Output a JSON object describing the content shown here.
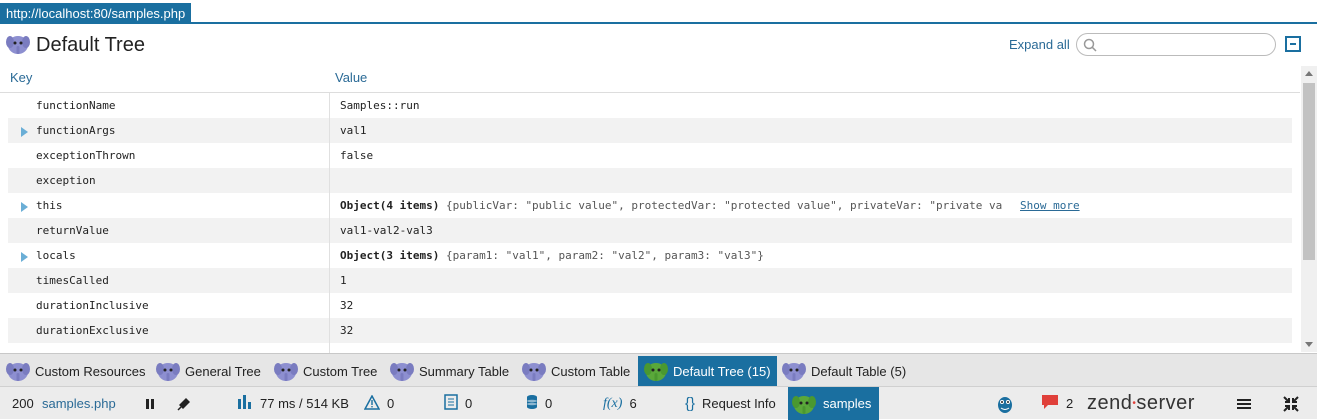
{
  "url": "http://localhost:80/samples.php",
  "panel": {
    "title": "Default Tree",
    "expand_all": "Expand all",
    "search_placeholder": ""
  },
  "columns": {
    "key": "Key",
    "value": "Value"
  },
  "rows": [
    {
      "key": "functionName",
      "value": "Samples::run",
      "expandable": false
    },
    {
      "key": "functionArgs",
      "value": "val1",
      "expandable": true
    },
    {
      "key": "exceptionThrown",
      "value": "false",
      "expandable": false
    },
    {
      "key": "exception",
      "value": "",
      "expandable": false
    },
    {
      "key": "this",
      "value_bold": "Object(4 items)",
      "value_preview": "{publicVar: \"public value\", protectedVar: \"protected value\", privateVar: \"private va",
      "show_more": "Show more",
      "expandable": true
    },
    {
      "key": "returnValue",
      "value": "val1-val2-val3",
      "expandable": false
    },
    {
      "key": "locals",
      "value_bold": "Object(3 items)",
      "value_preview": "{param1: \"val1\", param2: \"val2\", param3: \"val3\"}",
      "expandable": true
    },
    {
      "key": "timesCalled",
      "value": "1",
      "expandable": false
    },
    {
      "key": "durationInclusive",
      "value": "32",
      "expandable": false
    },
    {
      "key": "durationExclusive",
      "value": "32",
      "expandable": false
    },
    {
      "key": "",
      "value": "",
      "expandable": false
    }
  ],
  "tabs": [
    {
      "label": "Custom Resources",
      "active": false,
      "icon": "php-elephant-icon"
    },
    {
      "label": "General Tree",
      "active": false,
      "icon": "php-elephant-icon"
    },
    {
      "label": "Custom Tree",
      "active": false,
      "icon": "php-elephant-icon"
    },
    {
      "label": "Summary Table",
      "active": false,
      "icon": "php-elephant-icon"
    },
    {
      "label": "Custom Table",
      "active": false,
      "icon": "php-elephant-icon"
    },
    {
      "label": "Default Tree (15)",
      "active": true,
      "icon": "php-elephant-icon"
    },
    {
      "label": "Default Table (5)",
      "active": false,
      "icon": "php-elephant-icon"
    }
  ],
  "status": {
    "code": "200",
    "script": "samples.php",
    "timing": "77 ms / 514 KB",
    "warnings": "0",
    "logs": "0",
    "queries": "0",
    "functions_label": "f(x)",
    "functions": "6",
    "request_info_icon": "{}",
    "request_info": "Request Info",
    "extension": "samples",
    "notifications": "2",
    "brand_left": "zend",
    "brand_right": "server"
  },
  "colors": {
    "accent": "#1a6fa0",
    "elephant": "#8d8fd0",
    "elephant_active": "#5aa83a",
    "notification": "#e0403a"
  }
}
